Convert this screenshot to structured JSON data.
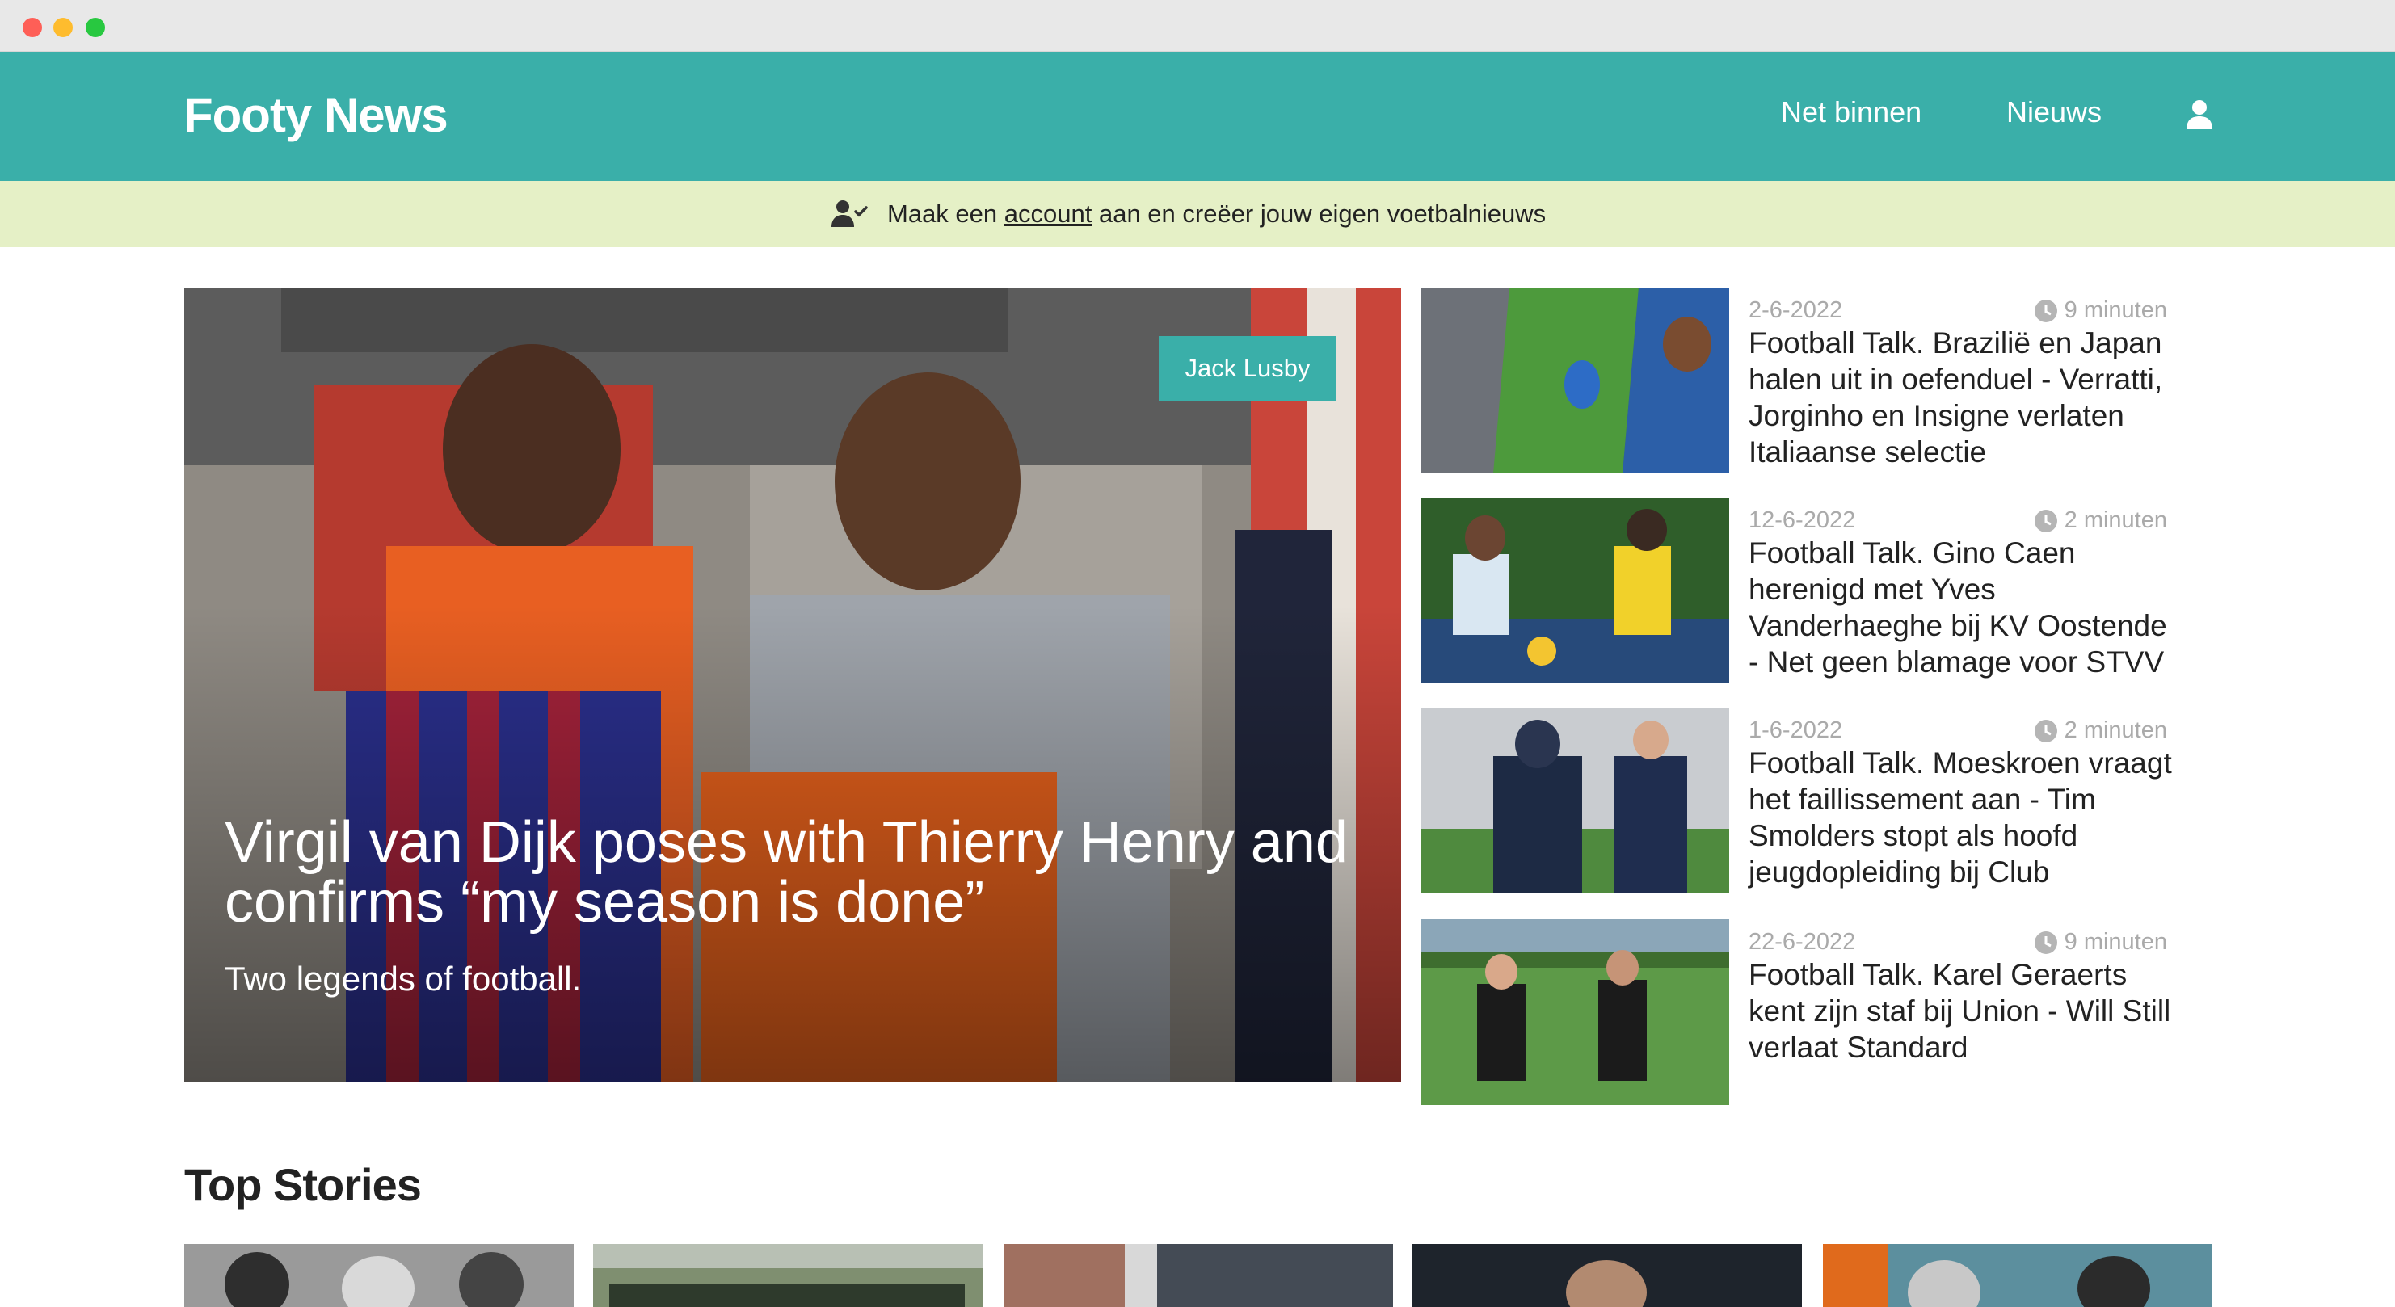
{
  "browser": {
    "window_controls": [
      "close",
      "minimize",
      "maximize"
    ]
  },
  "header": {
    "logo": "Footy News",
    "nav": [
      {
        "label": "Net binnen"
      },
      {
        "label": "Nieuws"
      }
    ],
    "user_icon": "user-icon",
    "background_color": "#3aafa9"
  },
  "banner": {
    "icon": "user-check-icon",
    "text_before": "Maak een ",
    "link": "account",
    "text_after": " aan en creëer jouw eigen voetbalnieuws",
    "background_color": "#e5f0c6"
  },
  "hero": {
    "author": "Jack Lusby",
    "title": "Virgil van Dijk poses with Thierry Henry and confirms “my season is done”",
    "subtitle": "Two legends of football."
  },
  "side_articles": [
    {
      "date": "2-6-2022",
      "read_time": "9 minuten",
      "title": "Football Talk. Brazilië en Japan halen uit in oefenduel - Verratti, Jorginho en Insigne verlaten Italiaanse selectie"
    },
    {
      "date": "12-6-2022",
      "read_time": "2 minuten",
      "title": "Football Talk. Gino Caen herenigd met Yves Vanderhaeghe bij KV Oostende - Net geen blamage voor STVV"
    },
    {
      "date": "1-6-2022",
      "read_time": "2 minuten",
      "title": "Football Talk. Moeskroen vraagt het faillissement aan - Tim Smolders stopt als hoofd jeugdopleiding bij Club"
    },
    {
      "date": "22-6-2022",
      "read_time": "9 minuten",
      "title": "Football Talk. Karel Geraerts kent zijn staf bij Union - Will Still verlaat Standard"
    }
  ],
  "top_stories": {
    "heading": "Top Stories",
    "count": 5
  }
}
